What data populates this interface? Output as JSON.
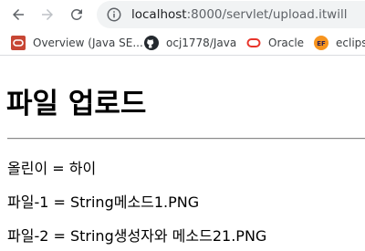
{
  "browser": {
    "url_host": "localhost",
    "url_path": ":8000/servlet/upload.itwill"
  },
  "bookmarks": [
    {
      "label": "Overview (Java SE...",
      "icon": "oracle-java-icon"
    },
    {
      "label": "ocj1778/Java",
      "icon": "github-icon"
    },
    {
      "label": "Oracle",
      "icon": "oracle-icon"
    },
    {
      "label": "eclipse",
      "icon": "eclipse-icon"
    }
  ],
  "page": {
    "title": "파일 업로드",
    "lines": [
      "올린이 = 하이",
      "파일-1 = String메소드1.PNG",
      "파일-2 = String생성자와 메소드21.PNG"
    ]
  }
}
